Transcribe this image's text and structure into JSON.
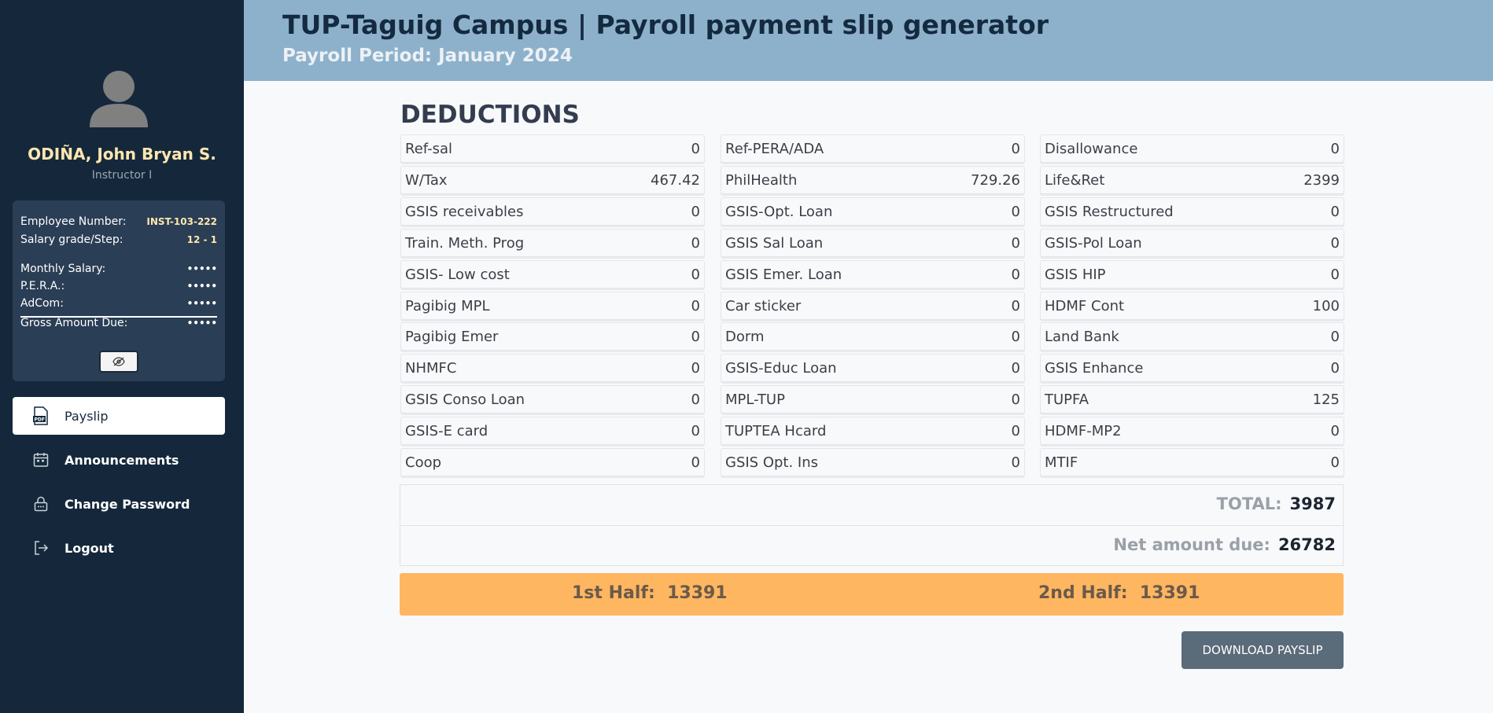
{
  "sidebar": {
    "user_name": "ODIÑA, John Bryan S.",
    "user_role": "Instructor I",
    "info": {
      "employee_number_label": "Employee Number:",
      "employee_number": "INST-103-222",
      "salary_grade_label": "Salary grade/Step:",
      "salary_grade": "12 - 1",
      "monthly_salary_label": "Monthly Salary:",
      "pera_label": "P.E.R.A.:",
      "adcom_label": "AdCom:",
      "gross_label": "Gross Amount Due:",
      "masked_value": "•••••"
    },
    "nav": [
      {
        "label": "Payslip",
        "icon": "pdf-icon"
      },
      {
        "label": "Announcements",
        "icon": "calendar-icon"
      },
      {
        "label": "Change Password",
        "icon": "lock-icon"
      },
      {
        "label": "Logout",
        "icon": "logout-icon"
      }
    ]
  },
  "header": {
    "title": "TUP-Taguig Campus | Payroll payment slip generator",
    "subtitle": "Payroll Period: January 2024"
  },
  "deductions": {
    "title": "DEDUCTIONS",
    "columns": [
      [
        {
          "label": "Ref-sal",
          "value": "0"
        },
        {
          "label": "W/Tax",
          "value": "467.42"
        },
        {
          "label": "GSIS receivables",
          "value": "0"
        },
        {
          "label": "Train. Meth. Prog",
          "value": "0"
        },
        {
          "label": "GSIS- Low cost",
          "value": "0"
        },
        {
          "label": "Pagibig MPL",
          "value": "0"
        },
        {
          "label": "Pagibig Emer",
          "value": "0"
        },
        {
          "label": "NHMFC",
          "value": "0"
        },
        {
          "label": "GSIS Conso Loan",
          "value": "0"
        },
        {
          "label": "GSIS-E card",
          "value": "0"
        },
        {
          "label": "Coop",
          "value": "0"
        }
      ],
      [
        {
          "label": "Ref-PERA/ADA",
          "value": "0"
        },
        {
          "label": "PhilHealth",
          "value": "729.26"
        },
        {
          "label": "GSIS-Opt. Loan",
          "value": "0"
        },
        {
          "label": "GSIS Sal Loan",
          "value": "0"
        },
        {
          "label": "GSIS Emer. Loan",
          "value": "0"
        },
        {
          "label": "Car sticker",
          "value": "0"
        },
        {
          "label": "Dorm",
          "value": "0"
        },
        {
          "label": "GSIS-Educ Loan",
          "value": "0"
        },
        {
          "label": "MPL-TUP",
          "value": "0"
        },
        {
          "label": "TUPTEA Hcard",
          "value": "0"
        },
        {
          "label": "GSIS Opt. Ins",
          "value": "0"
        }
      ],
      [
        {
          "label": "Disallowance",
          "value": "0"
        },
        {
          "label": "Life&Ret",
          "value": "2399"
        },
        {
          "label": "GSIS Restructured",
          "value": "0"
        },
        {
          "label": "GSIS-Pol Loan",
          "value": "0"
        },
        {
          "label": "GSIS HIP",
          "value": "0"
        },
        {
          "label": "HDMF Cont",
          "value": "100"
        },
        {
          "label": "Land Bank",
          "value": "0"
        },
        {
          "label": "GSIS Enhance",
          "value": "0"
        },
        {
          "label": "TUPFA",
          "value": "125"
        },
        {
          "label": "HDMF-MP2",
          "value": "0"
        },
        {
          "label": "MTIF",
          "value": "0"
        }
      ]
    ]
  },
  "totals": {
    "total_label": "TOTAL:",
    "total_value": "3987",
    "net_label": "Net amount due:",
    "net_value": "26782"
  },
  "halves": {
    "first_label": "1st Half:",
    "first_value": "13391",
    "second_label": "2nd Half:",
    "second_value": "13391"
  },
  "download_label": "DOWNLOAD PAYSLIP",
  "colors": {
    "sidebar_bg": "#15283b",
    "header_bg": "#8eb1cb",
    "accent_name": "#ffe7b0",
    "halves_bg": "#ffb661",
    "button_bg": "#5a6b7a"
  }
}
